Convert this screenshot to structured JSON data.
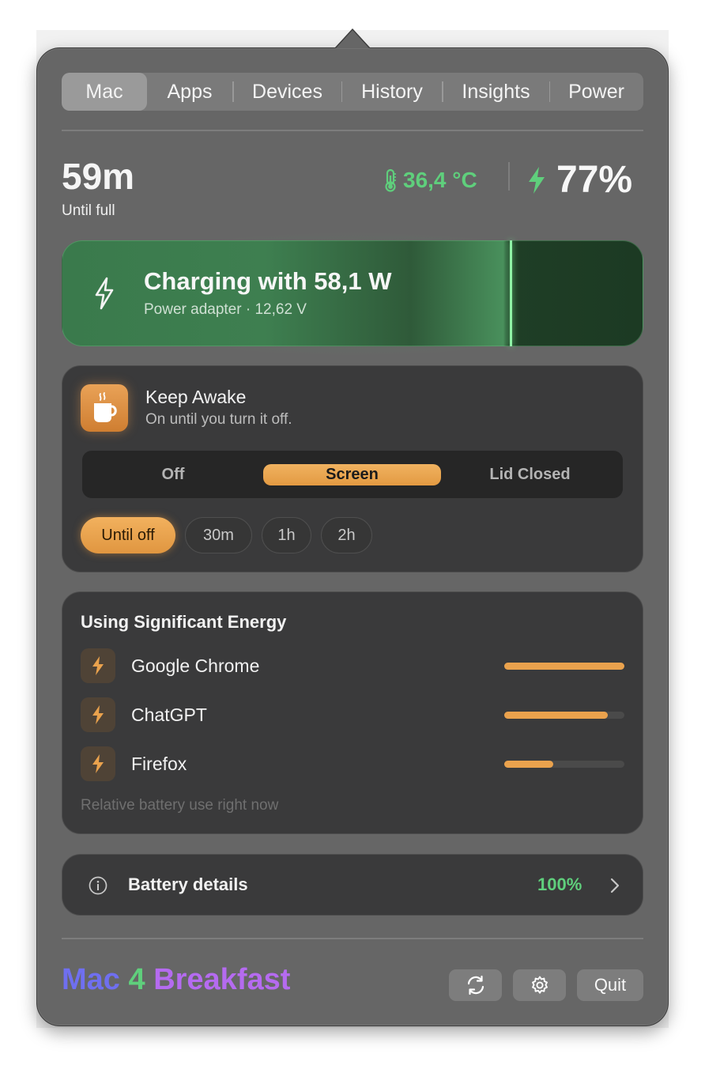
{
  "tabs": [
    {
      "label": "Mac",
      "active": true
    },
    {
      "label": "Apps",
      "active": false
    },
    {
      "label": "Devices",
      "active": false
    },
    {
      "label": "History",
      "active": false
    },
    {
      "label": "Insights",
      "active": false
    },
    {
      "label": "Power",
      "active": false
    }
  ],
  "summary": {
    "time_remaining": "59m",
    "time_label": "Until full",
    "temperature": "36,4 °C",
    "battery_percent": "77%",
    "battery_level": 0.77
  },
  "charging": {
    "title": "Charging with 58,1 W",
    "subtitle": "Power adapter · 12,62 V"
  },
  "keep_awake": {
    "title": "Keep Awake",
    "subtitle": "On until you turn it off.",
    "modes": [
      "Off",
      "Screen",
      "Lid Closed"
    ],
    "selected_mode": "Screen",
    "durations": [
      "Until off",
      "30m",
      "1h",
      "2h"
    ],
    "selected_duration": "Until off"
  },
  "energy": {
    "title": "Using Significant Energy",
    "apps": [
      {
        "name": "Google Chrome",
        "level": 1.0
      },
      {
        "name": "ChatGPT",
        "level": 0.86
      },
      {
        "name": "Firefox",
        "level": 0.41
      }
    ],
    "footnote": "Relative battery use right now"
  },
  "battery_details": {
    "label": "Battery details",
    "value": "100%"
  },
  "footer": {
    "brand_part1": "Mac",
    "brand_part2": "4",
    "brand_part3": "Breakfast",
    "quit_label": "Quit"
  },
  "colors": {
    "accent_orange": "#eaa24d",
    "accent_green": "#5fcf7c",
    "brand_blue": "#6f6ff0",
    "brand_purple": "#b56bf0"
  },
  "icons": {
    "temperature": "thermometer-icon",
    "charging": "bolt-icon",
    "keep_awake": "coffee-cup-icon",
    "app_energy": "bolt-icon",
    "details": "info-icon",
    "refresh": "refresh-icon",
    "settings": "gear-icon"
  }
}
